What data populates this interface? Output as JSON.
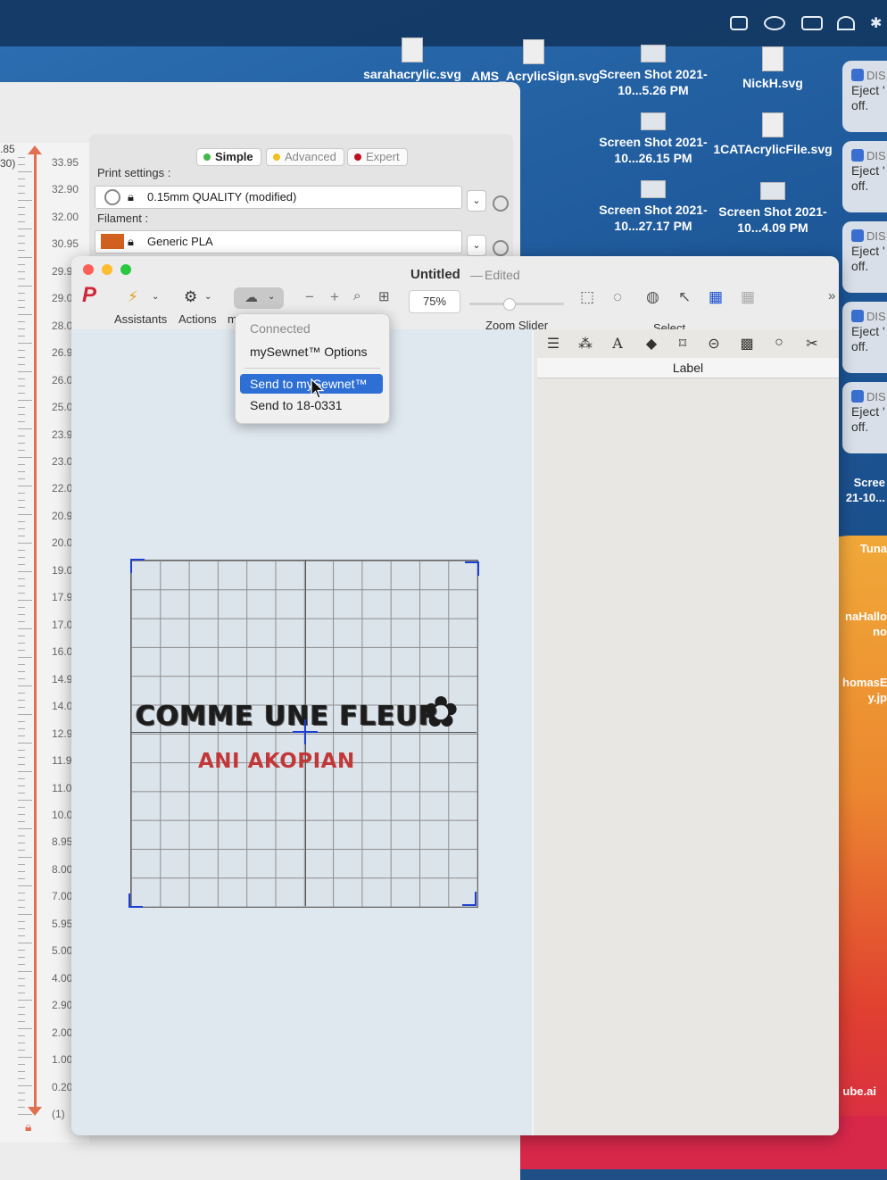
{
  "desktop": {
    "icons": [
      {
        "label": "sarahacrylic.svg"
      },
      {
        "label": "AMS_AcrylicSign.svg"
      },
      {
        "label": "Screen Shot 2021-10...5.26 PM"
      },
      {
        "label": "NickH.svg"
      },
      {
        "label": "Screen Shot 2021-10...26.15 PM"
      },
      {
        "label": "1CATAcrylicFile.svg"
      },
      {
        "label": "Screen Shot 2021-10...27.17 PM"
      },
      {
        "label": "Screen Shot 2021-10...4.09 PM"
      }
    ],
    "notifications": [
      {
        "title": "DIS",
        "body": "Eject ' off."
      },
      {
        "title": "DIS",
        "body": "Eject ' it off."
      },
      {
        "title": "DIS",
        "body": "Eject ' it off."
      },
      {
        "title": "DIS",
        "body": "Eject ' off."
      },
      {
        "title": "DIS",
        "body": "Eject ' it off."
      }
    ],
    "partial_labels": [
      "Scree 21-10...",
      "Tuna",
      "naHallo no",
      "homasE y.jp",
      "ube.ai"
    ]
  },
  "slicer": {
    "ruler_values": [
      "33.95",
      "32.90",
      "32.00",
      "30.95",
      "29.95",
      "29.0",
      "28.0",
      "26.9",
      "26.0",
      "25.0",
      "23.9",
      "23.0",
      "22.0",
      "20.9",
      "20.0",
      "19.0",
      "17.9",
      "17.0",
      "16.0",
      "14.9",
      "14.0",
      "12.9",
      "11.9",
      "11.0",
      "10.0",
      "8.95",
      "8.00",
      "7.00",
      "5.95",
      "5.00",
      "4.00",
      "2.90",
      "2.00",
      "1.00",
      "0.20",
      "(1)"
    ],
    "top_left_value": ".85",
    "top_left_sub": "30)",
    "modes": {
      "simple": "Simple",
      "advanced": "Advanced",
      "expert": "Expert"
    },
    "print_settings_label": "Print settings :",
    "print_settings_value": "0.15mm QUALITY (modified)",
    "filament_label": "Filament :",
    "filament_value": "Generic PLA",
    "filament_color": "#d2611f"
  },
  "window": {
    "title": "Untitled",
    "separator": "—",
    "status": "Edited",
    "toolbar": {
      "assistants": "Assistants",
      "actions": "Actions",
      "cut_label": "m",
      "zoom_value": "75%",
      "zoom_slider": "Zoom Slider",
      "select": "Select"
    },
    "panel_label": "Label"
  },
  "menu": {
    "header": "Connected",
    "options": "mySewnet™ Options",
    "send_mysewnet": "Send to mySewnet™",
    "send_device": "Send to 18-0331"
  },
  "design": {
    "main_text": "COMME UNE FLEUR",
    "sub_text": "ANI AKOPIAN",
    "sub_color": "#c23838"
  }
}
